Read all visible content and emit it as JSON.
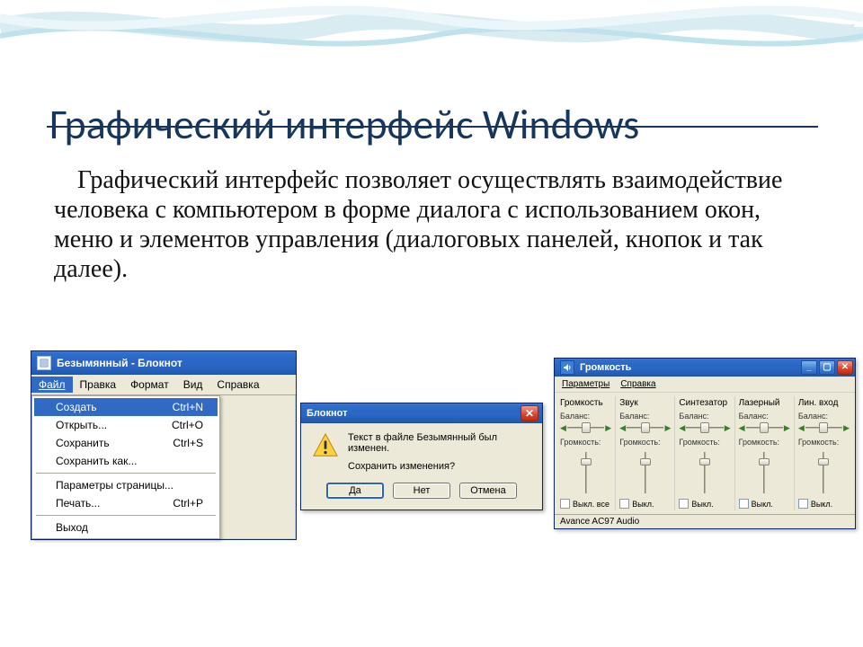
{
  "title": "Графический интерфейс Windows",
  "body": "Графический интерфейс позволяет осуществлять взаимодействие человека с компьютером в форме диалога с использованием окон, меню и элементов управления (диалоговых панелей, кнопок и так далее).",
  "notepad": {
    "window_title": "Безымянный - Блокнот",
    "menubar": {
      "file": "Файл",
      "edit": "Правка",
      "format": "Формат",
      "view": "Вид",
      "help": "Справка"
    },
    "file_menu": {
      "new": {
        "label": "Создать",
        "shortcut": "Ctrl+N"
      },
      "open": {
        "label": "Открыть...",
        "shortcut": "Ctrl+O"
      },
      "save": {
        "label": "Сохранить",
        "shortcut": "Ctrl+S"
      },
      "save_as": {
        "label": "Сохранить как...",
        "shortcut": ""
      },
      "page_setup": {
        "label": "Параметры страницы...",
        "shortcut": ""
      },
      "print": {
        "label": "Печать...",
        "shortcut": "Ctrl+P"
      },
      "exit": {
        "label": "Выход",
        "shortcut": ""
      }
    }
  },
  "msgbox": {
    "title": "Блокнот",
    "line1": "Текст в файле Безымянный был изменен.",
    "line2": "Сохранить изменения?",
    "yes": "Да",
    "no": "Нет",
    "cancel": "Отмена"
  },
  "mixer": {
    "title": "Громкость",
    "menu": {
      "params": "Параметры",
      "help": "Справка"
    },
    "labels": {
      "balance": "Баланс:",
      "volume": "Громкость:"
    },
    "channels": [
      {
        "name": "Громкость",
        "mute_label": "Выкл. все",
        "thumb_pct": 20
      },
      {
        "name": "Звук",
        "mute_label": "Выкл.",
        "thumb_pct": 20
      },
      {
        "name": "Синтезатор",
        "mute_label": "Выкл.",
        "thumb_pct": 20
      },
      {
        "name": "Лазерный",
        "mute_label": "Выкл.",
        "thumb_pct": 20
      },
      {
        "name": "Лин. вход",
        "mute_label": "Выкл.",
        "thumb_pct": 20
      }
    ],
    "status": "Avance AC97 Audio"
  }
}
